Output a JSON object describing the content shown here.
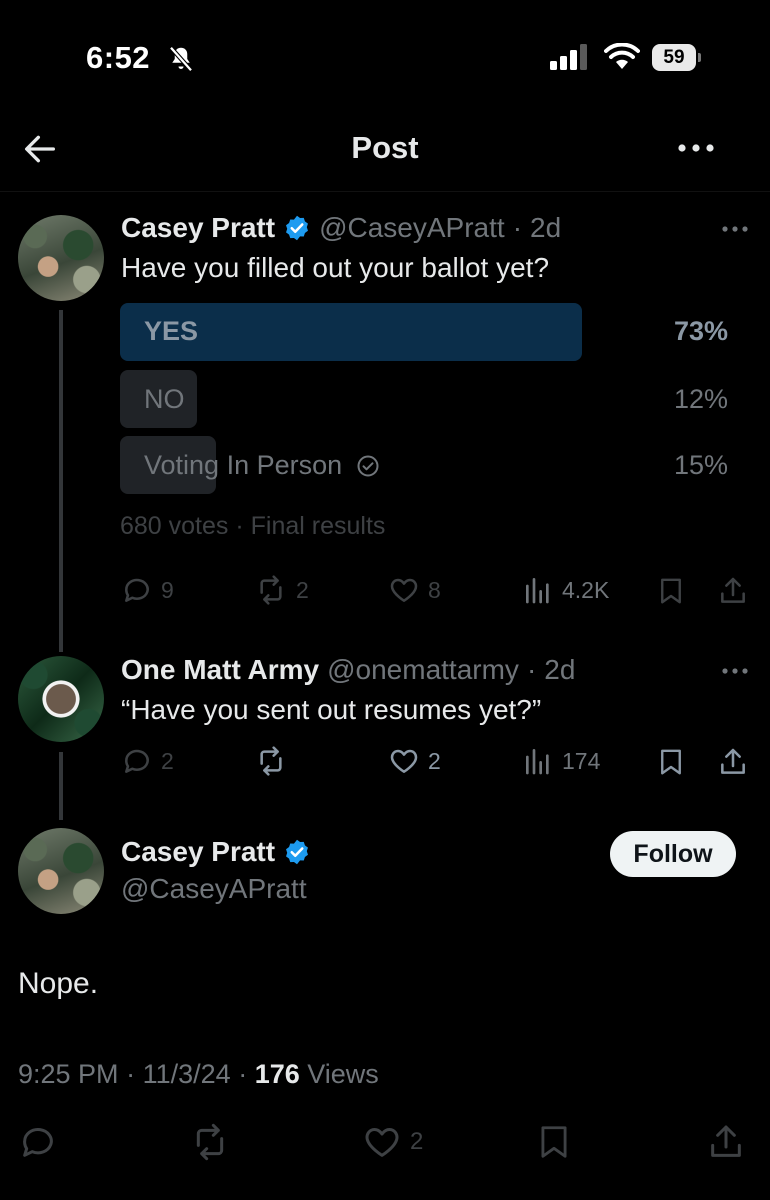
{
  "status_bar": {
    "time": "6:52",
    "battery": "59"
  },
  "header": {
    "title": "Post"
  },
  "poll_post": {
    "author_name": "Casey Pratt",
    "handle": "@CaseyAPratt",
    "age": "2d",
    "text": "Have you filled out your ballot yet?",
    "poll": {
      "options": [
        {
          "label": "YES",
          "percent_label": "73%",
          "percent": 73,
          "winner": true
        },
        {
          "label": "NO",
          "percent_label": "12%",
          "percent": 12,
          "winner": false
        },
        {
          "label": "Voting In Person",
          "percent_label": "15%",
          "percent": 15,
          "winner": false
        }
      ],
      "footer": "680 votes · Final results"
    },
    "actions": {
      "replies": "9",
      "reposts": "2",
      "likes": "8",
      "views": "4.2K"
    }
  },
  "reply_post": {
    "author_name": "One Matt Army",
    "handle": "@onemattarmy",
    "age": "2d",
    "text": "“Have you sent out resumes yet?”",
    "actions": {
      "replies": "2",
      "reposts": "",
      "likes": "2",
      "views": "174"
    }
  },
  "main_post": {
    "author_name": "Casey Pratt",
    "handle": "@CaseyAPratt",
    "follow_label": "Follow",
    "text": "Nope.",
    "time": "9:25 PM",
    "date": "11/3/24",
    "views_count": "176",
    "views_label": "Views",
    "actions": {
      "likes": "2"
    }
  },
  "colors": {
    "background": "#000000",
    "verified": "#1d9bf0",
    "poll_winner_bar": "#0b2e4a",
    "poll_bar": "#202327",
    "muted_text": "#71767b"
  }
}
